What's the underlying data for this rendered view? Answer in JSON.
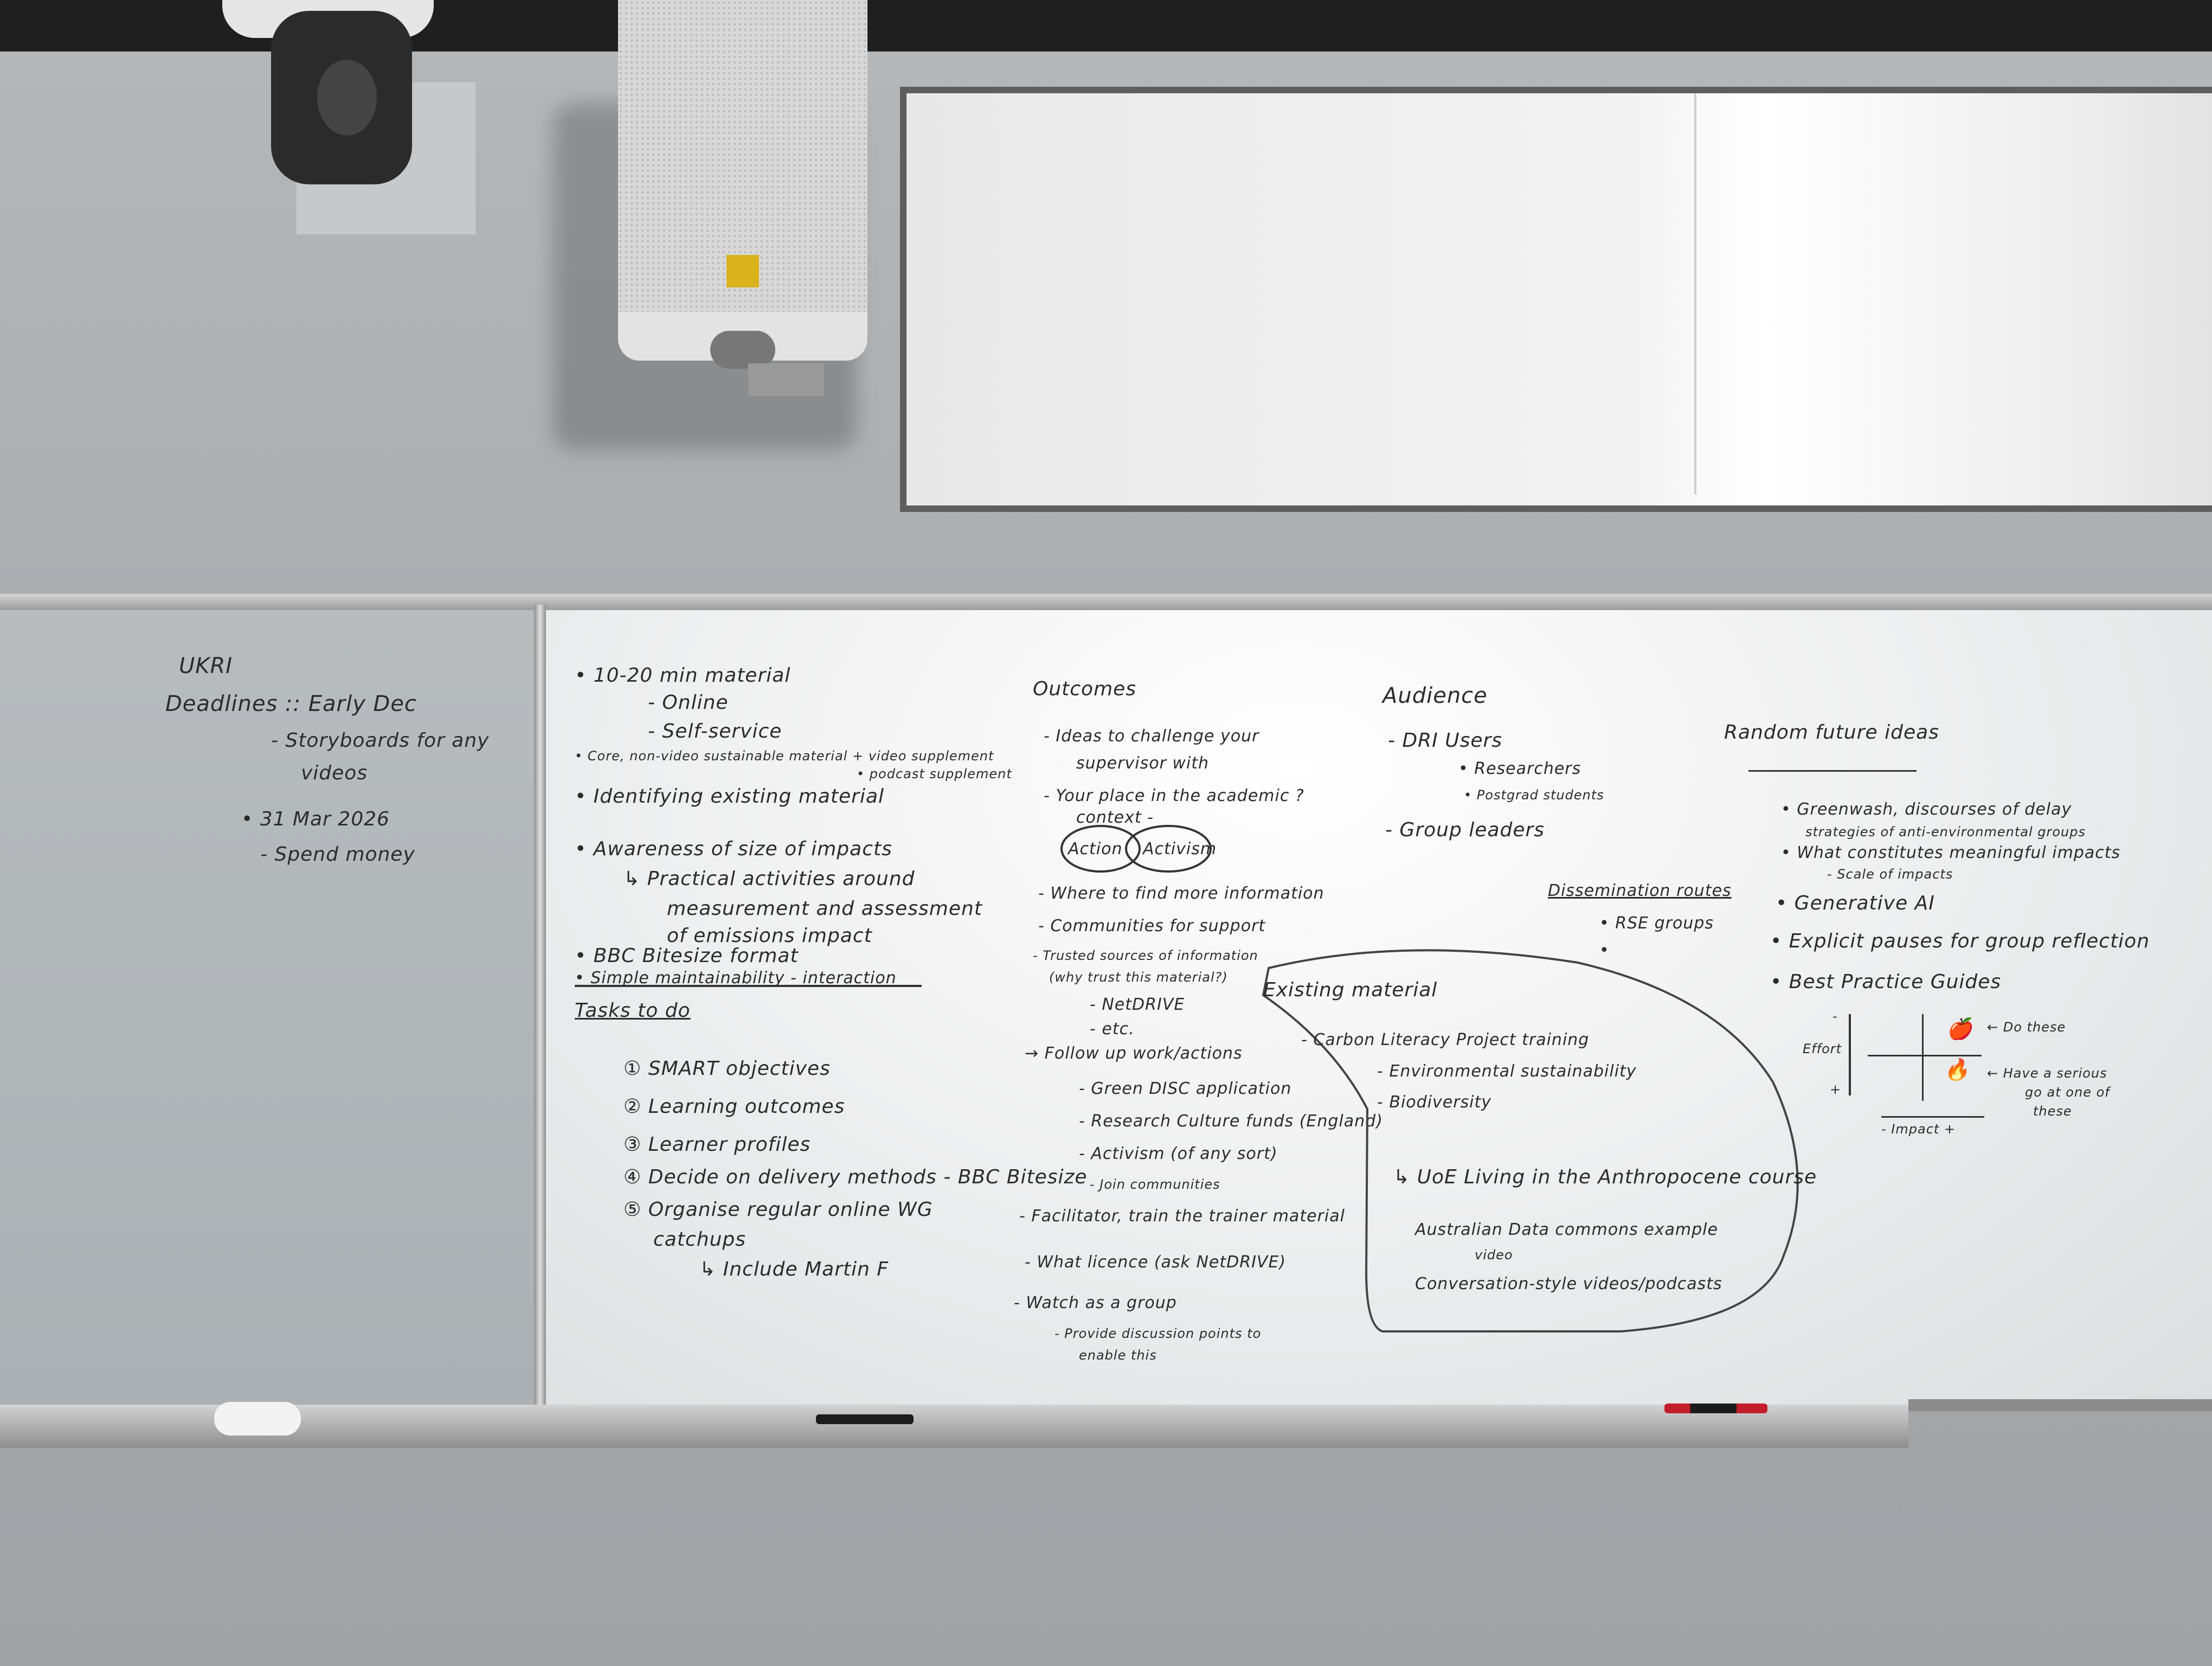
{
  "left_board": {
    "ukri": "UKRI",
    "deadlines": "Deadlines :: Early Dec",
    "storyboards": "- Storyboards for any",
    "videos": "videos",
    "date": "• 31 Mar 2026",
    "spend": "- Spend money"
  },
  "col1": {
    "material": "• 10-20 min material",
    "online": "- Online",
    "self_service": "- Self-service",
    "core": "• Core, non-video sustainable material + video supplement",
    "podcast": "• podcast supplement",
    "identifying": "• Identifying existing material",
    "awareness": "• Awareness of size of impacts",
    "practical": "↳ Practical activities around",
    "measurement": "measurement and assessment",
    "emissions": "of emissions impact",
    "bbc": "• BBC Bitesize format",
    "simple": "• Simple maintainability - interaction",
    "tasks_title": "Tasks to do",
    "tasks": [
      "① SMART objectives",
      "② Learning outcomes",
      "③ Learner profiles",
      "④ Decide on delivery methods - BBC Bitesize",
      "⑤ Organise regular online WG",
      "catchups",
      "↳ Include Martin F"
    ]
  },
  "col2": {
    "title": "Outcomes",
    "items": [
      "- Ideas to challenge your",
      "supervisor with",
      "- Your place in the academic ?",
      "context -",
      "Action",
      "Activism",
      "- Where to find more information",
      "- Communities for support",
      "- Trusted sources of information",
      "(why trust this material?)",
      "- NetDRIVE",
      "- etc.",
      "→ Follow up work/actions",
      "- Green DISC application",
      "- Research Culture funds (England)",
      "- Activism (of any sort)",
      "- Join communities",
      "- Facilitator, train the trainer material",
      "- What licence (ask NetDRIVE)",
      "- Watch as a group",
      "- Provide discussion points to",
      "enable this"
    ]
  },
  "col3": {
    "title": "Audience",
    "dri": "- DRI Users",
    "researchers": "• Researchers",
    "postgrads": "• Postgrad students",
    "group_leaders": "- Group leaders",
    "dissemination": "Dissemination routes",
    "rse": "• RSE groups",
    "bullet": "•",
    "existing_title": "Existing material",
    "carbon": "- Carbon Literacy Project training",
    "environmental": "- Environmental sustainability",
    "biodiversity": "- Biodiversity",
    "uoe": "↳ UoE Living in the Anthropocene course",
    "australia": "Australian Data commons example",
    "video": "video",
    "conversation": "Conversation-style videos/podcasts"
  },
  "col4": {
    "title": "Random future ideas",
    "greenwash": "• Greenwash, discourses of delay",
    "strategies": "strategies of anti-environmental groups",
    "meaningful": "• What constitutes meaningful impacts",
    "scale": "- Scale of impacts",
    "genai": "• Generative AI",
    "pauses": "• Explicit pauses for group reflection",
    "guides": "• Best Practice Guides",
    "effort": "Effort",
    "do_these": "← Do these",
    "have_serious": "← Have a serious",
    "go_at": "go at one of",
    "these": "these",
    "impact": "- Impact +",
    "minus": "-",
    "plus": "+"
  }
}
